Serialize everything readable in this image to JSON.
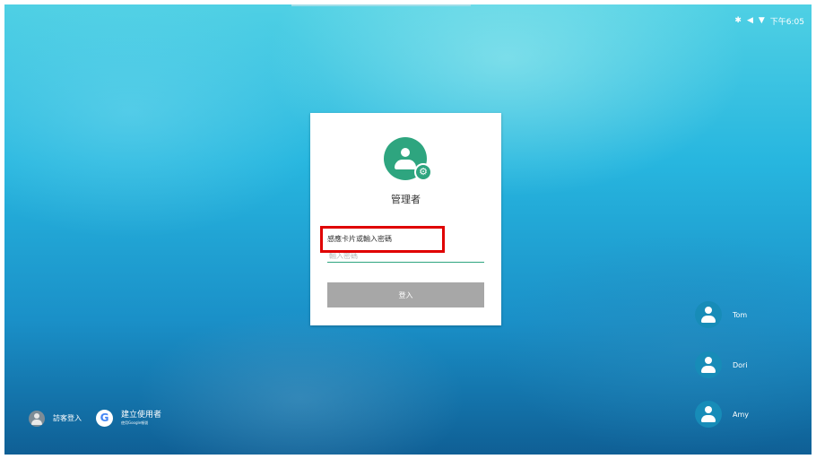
{
  "status_bar": {
    "time": "下午6:05",
    "icons": [
      "bluetooth-icon",
      "volume-icon",
      "wifi-icon"
    ]
  },
  "login_card": {
    "title": "管理者",
    "hint": "感應卡片或輸入密碼",
    "password_placeholder": "輸入密碼",
    "login_button": "登入",
    "accent_color": "#2ea57f",
    "button_color": "#a7a7a7",
    "highlight_color": "#e00000"
  },
  "users": [
    {
      "name": "Tom"
    },
    {
      "name": "Dori"
    },
    {
      "name": "Amy"
    }
  ],
  "bottom": {
    "guest_label": "訪客登入",
    "create_label": "建立使用者",
    "create_sub": "使用Google帳號"
  }
}
